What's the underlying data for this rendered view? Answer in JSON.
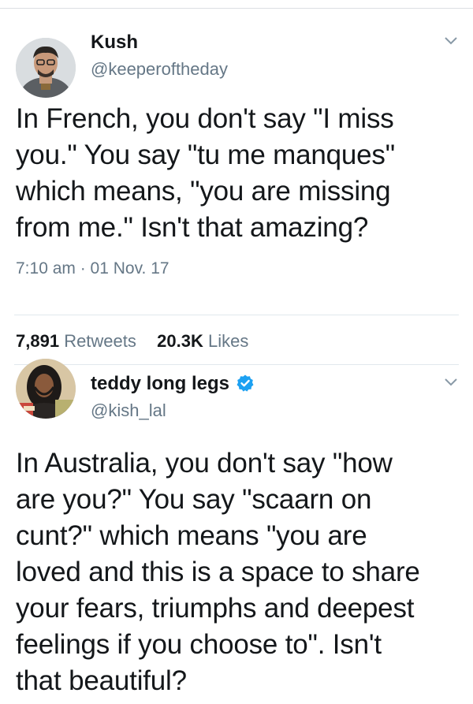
{
  "tweets": [
    {
      "name": "Kush",
      "handle": "@keeperoftheday",
      "verified": false,
      "text": "In French, you don't say \"I miss\nyou.\" You say \"tu me manques\"\nwhich means, \"you are missing\nfrom me.\" Isn't that amazing?",
      "timestamp": "7:10 am · 01 Nov. 17",
      "retweets_count": "7,891",
      "retweets_label": "Retweets",
      "likes_count": "20.3K",
      "likes_label": "Likes"
    },
    {
      "name": "teddy long legs",
      "handle": "@kish_lal",
      "verified": true,
      "text": "In Australia, you don't say \"how\nare you?\" You say \"scaarn on\ncunt?\" which means \"you are\nloved and this is a space to share\nyour fears, triumphs and deepest\nfeelings if you choose to\". Isn't\nthat beautiful?"
    }
  ],
  "colors": {
    "text": "#14171a",
    "secondary": "#657786",
    "verified": "#1da1f2",
    "divider": "#e1e8ed"
  },
  "icons": [
    "chevron-down-icon",
    "verified-badge-icon"
  ]
}
